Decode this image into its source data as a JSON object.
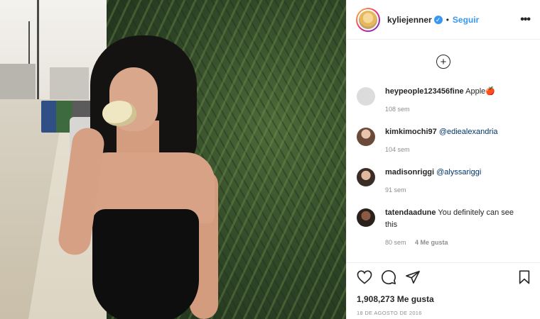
{
  "header": {
    "username": "kyliejenner",
    "verified_glyph": "✓",
    "separator": "•",
    "follow_label": "Seguir",
    "more_glyph": "•••"
  },
  "comments": {
    "load_more_glyph": "+",
    "items": [
      {
        "user": "heypeople123456fine",
        "text": "Apple🍎",
        "time": "108 sem",
        "likes": ""
      },
      {
        "user": "kimkimochi97",
        "text": "@ediealexandria",
        "time": "104 sem",
        "likes": ""
      },
      {
        "user": "madisonriggi",
        "text": "@alyssariggi",
        "time": "91 sem",
        "likes": ""
      },
      {
        "user": "tatendaadune",
        "text": "You definitely can see this",
        "time": "80 sem",
        "likes": "4 Me gusta"
      }
    ]
  },
  "post": {
    "likes": "1,908,273 Me gusta",
    "date": "18 DE AGOSTO DE 2016"
  },
  "icons": {
    "like": "heart-icon",
    "comment": "comment-icon",
    "share": "share-icon",
    "save": "bookmark-icon",
    "add": "plus-circle-icon",
    "more": "more-options-icon",
    "verified": "verified-badge-icon"
  },
  "colors": {
    "accent": "#3897f0",
    "text": "#262626",
    "muted": "#8e8e8e",
    "mention": "#003569"
  }
}
